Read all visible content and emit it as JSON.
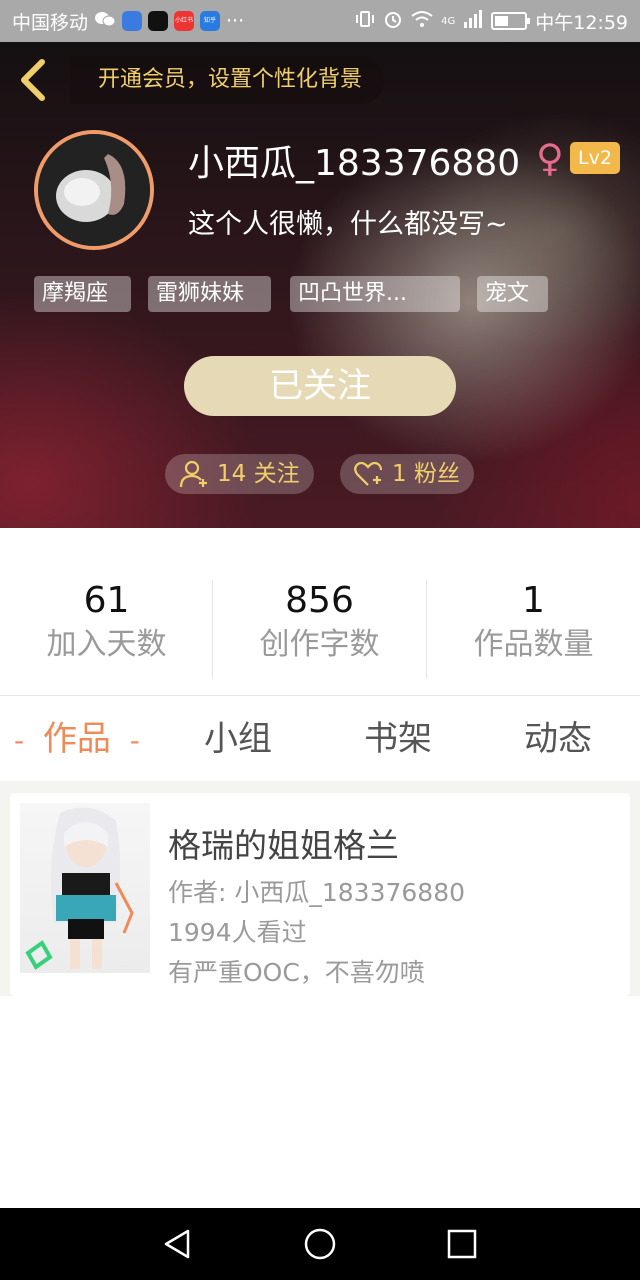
{
  "status_bar": {
    "carrier": "中国移动",
    "icons": [
      "wechat-icon",
      "app-icon",
      "tiktok-icon",
      "xiaohongshu-icon",
      "zhihu-icon"
    ],
    "app_labels": [
      "小红书",
      "知乎"
    ],
    "more": "···",
    "network": "4G",
    "battery_level": 0.45,
    "time": "中午12:59"
  },
  "header": {
    "vip_banner": "开通会员，设置个性化背景",
    "username": "小西瓜_183376880",
    "gender_symbol": "♀",
    "level": "Lv2",
    "bio": "这个人很懒，什么都没写~",
    "tags": [
      "摩羯座",
      "雷狮妹妹",
      "凹凸世界...",
      "宠文"
    ],
    "follow_button": "已关注",
    "following": "14 关注",
    "fans": "1 粉丝"
  },
  "stats": [
    {
      "value": "61",
      "label": "加入天数"
    },
    {
      "value": "856",
      "label": "创作字数"
    },
    {
      "value": "1",
      "label": "作品数量"
    }
  ],
  "tabs": {
    "active_dash": "-",
    "items": [
      "作品",
      "小组",
      "书架",
      "动态"
    ]
  },
  "works": [
    {
      "title": "格瑞的姐姐格兰",
      "author": "作者: 小西瓜_183376880",
      "views": "1994人看过",
      "desc": "有严重OOC，不喜勿喷"
    }
  ],
  "colors": {
    "accent": "#f08b58",
    "gold": "#f0cf6a",
    "level_badge": "#f3b84a",
    "follow_button": "#e5d9b6"
  }
}
